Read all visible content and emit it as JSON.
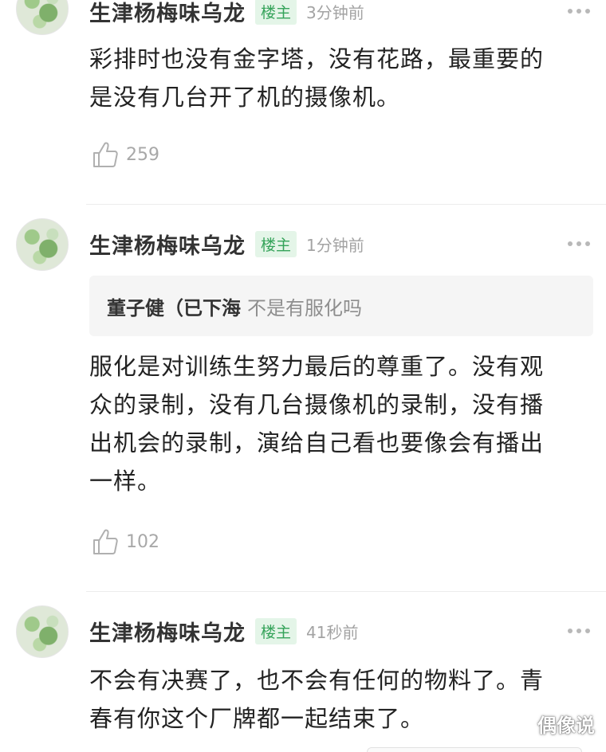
{
  "comments": [
    {
      "username": "生津杨梅味乌龙",
      "badge": "楼主",
      "time": "3分钟前",
      "lines": [
        "彩排时也没有金字塔，没有花路，最重要的",
        "是没有几台开了机的摄像机。"
      ],
      "likes": "259"
    },
    {
      "username": "生津杨梅味乌龙",
      "badge": "楼主",
      "time": "1分钟前",
      "quote": {
        "user": "董子健（已下海",
        "text": "不是有服化吗"
      },
      "lines": [
        "服化是对训练生努力最后的尊重了。没有观",
        "众的录制，没有几台摄像机的录制，没有播",
        "出机会的录制，演给自己看也要像会有播出",
        "一样。"
      ],
      "likes": "102"
    },
    {
      "username": "生津杨梅味乌龙",
      "badge": "楼主",
      "time": "41秒前",
      "lines": [
        "不会有决赛了，也不会有任何的物料了。青",
        "春有你这个厂牌都一起结束了。"
      ]
    }
  ],
  "watermark": "偶像说",
  "colors": {
    "badge_text": "#35a35a",
    "badge_bg": "#e4f5e8",
    "meta": "#a3a3a3"
  },
  "icons": {
    "like": "thumbs-up-icon",
    "more": "more-dots-icon"
  }
}
